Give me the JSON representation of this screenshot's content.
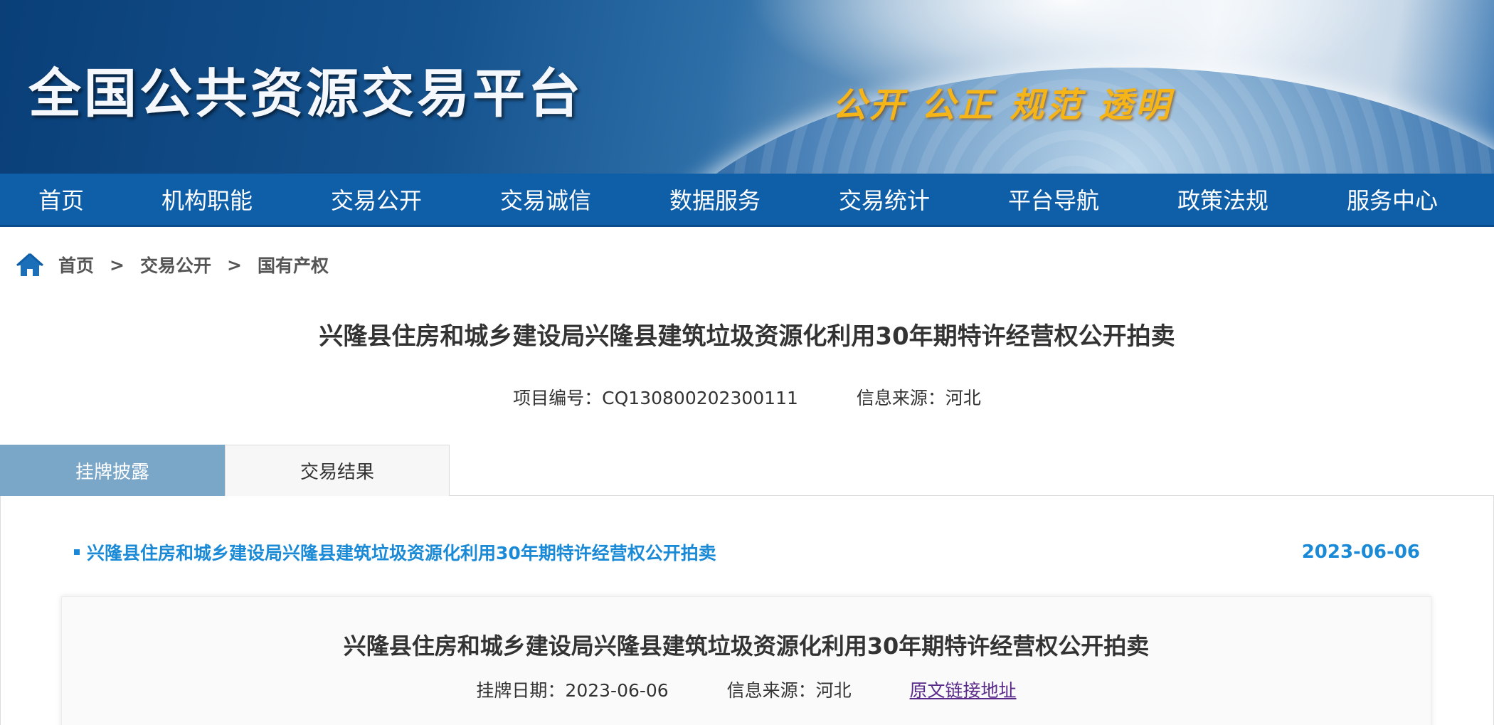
{
  "header": {
    "site_title": "全国公共资源交易平台",
    "slogan": "公开 公正 规范 透明"
  },
  "nav": {
    "items": [
      "首页",
      "机构职能",
      "交易公开",
      "交易诚信",
      "数据服务",
      "交易统计",
      "平台导航",
      "政策法规",
      "服务中心"
    ]
  },
  "breadcrumb": {
    "items": [
      "首页",
      "交易公开",
      "国有产权"
    ],
    "separator": ">"
  },
  "project": {
    "title": "兴隆县住房和城乡建设局兴隆县建筑垃圾资源化利用30年期特许经营权公开拍卖",
    "code_label": "项目编号：CQ130800202300111",
    "source_label": "信息来源：河北"
  },
  "tabs": {
    "active": "挂牌披露",
    "inactive": "交易结果"
  },
  "notice": {
    "title": "兴隆县住房和城乡建设局兴隆县建筑垃圾资源化利用30年期特许经营权公开拍卖",
    "date": "2023-06-06"
  },
  "detail": {
    "title": "兴隆县住房和城乡建设局兴隆县建筑垃圾资源化利用30年期特许经营权公开拍卖",
    "listing_date": "挂牌日期：2023-06-06",
    "source": "信息来源：河北",
    "original_link": "原文链接地址"
  },
  "colors": {
    "nav_bg": "#0f5ea8",
    "tab_active_bg": "#7aa6c8",
    "link_blue": "#1a8ad6",
    "slogan_gold": "#f5b418"
  }
}
